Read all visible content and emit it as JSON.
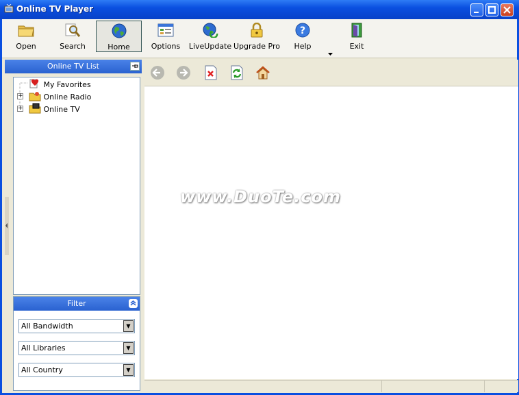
{
  "window": {
    "title": "Online TV Player"
  },
  "toolbar": {
    "items": [
      {
        "label": "Open",
        "icon": "folder-icon"
      },
      {
        "label": "Search",
        "icon": "search-icon"
      },
      {
        "label": "Home",
        "icon": "globe-icon"
      },
      {
        "label": "Options",
        "icon": "options-icon"
      },
      {
        "label": "LiveUpdate",
        "icon": "liveupdate-icon"
      },
      {
        "label": "Upgrade Pro",
        "icon": "lock-icon"
      },
      {
        "label": "Help",
        "icon": "help-icon"
      },
      {
        "label": "Exit",
        "icon": "exit-door-icon"
      }
    ]
  },
  "left_panel": {
    "title": "Online TV List",
    "tree": [
      {
        "label": "My Favorites"
      },
      {
        "label": "Online Radio"
      },
      {
        "label": "Online TV"
      }
    ]
  },
  "filter": {
    "title": "Filter",
    "selects": [
      {
        "value": "All Bandwidth"
      },
      {
        "value": "All Libraries"
      },
      {
        "value": "All Country"
      }
    ]
  },
  "content": {
    "watermark": "www.DuoTe.com"
  },
  "colors": {
    "titlebar": "#0a4fe0",
    "panel_header": "#2a62d0",
    "background": "#ece9d8"
  }
}
